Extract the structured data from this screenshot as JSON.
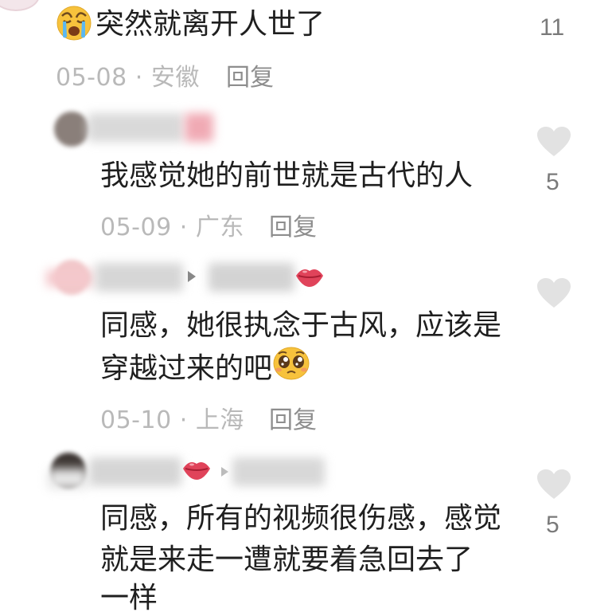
{
  "comments": [
    {
      "text": "突然就离开人世了",
      "date": "05-08",
      "location": "安徽",
      "reply_label": "回复",
      "like_count": "11",
      "emoji": "crying-face"
    },
    {
      "text": "我感觉她的前世就是古代的人",
      "date": "05-09",
      "location": "广东",
      "reply_label": "回复",
      "like_count": "5"
    },
    {
      "text_line1": "同感，她很执念于古风，应该是",
      "text_line2": "穿越过来的吧",
      "emoji": "pleading-face",
      "date": "05-10",
      "location": "上海",
      "reply_label": "回复",
      "like_count": ""
    },
    {
      "text_line1": "同感，所有的视频很伤感，感觉",
      "text_line2": "就是来走一遭就要着急回去了",
      "text_line3": "一样",
      "like_count": "5"
    }
  ],
  "separator": "·",
  "colors": {
    "meta_gray": "#b9b9b9",
    "heart_gray": "#e2e2e2",
    "lips_red": "#e0435a"
  }
}
